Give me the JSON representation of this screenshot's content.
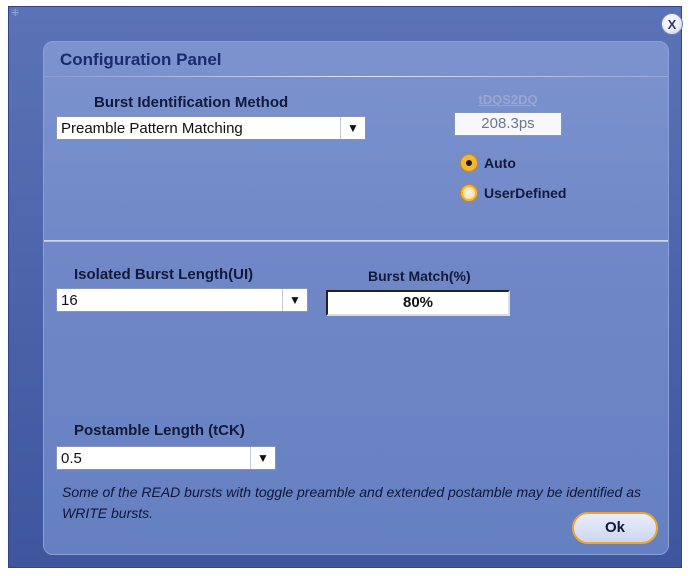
{
  "window": {
    "close_label": "X"
  },
  "panel": {
    "title": "Configuration Panel"
  },
  "burst_identification": {
    "label": "Burst Identification Method",
    "selected": "Preamble Pattern Matching"
  },
  "tdqs2dq": {
    "label": "tDQS2DQ",
    "value": "208.3ps"
  },
  "mode": {
    "options": [
      {
        "label": "Auto",
        "selected": true
      },
      {
        "label": "UserDefined",
        "selected": false
      }
    ]
  },
  "isolated_burst": {
    "label": "Isolated Burst Length(UI)",
    "selected": "16"
  },
  "burst_match": {
    "label": "Burst Match(%)",
    "value": "80%"
  },
  "postamble": {
    "label": "Postamble Length (tCK)",
    "selected": "0.5"
  },
  "note": {
    "text": "Some of the READ bursts with toggle preamble and extended postamble may be identified as WRITE bursts."
  },
  "actions": {
    "ok_label": "Ok"
  },
  "colors": {
    "window_bg": "#4a62a8",
    "panel_bg": "#6f87c6",
    "title_text": "#1a2a6e",
    "radio_accent": "#f5b733",
    "ok_border": "#f0a528"
  },
  "icons": {
    "dropdown": "chevron-down-icon",
    "close": "close-icon"
  }
}
